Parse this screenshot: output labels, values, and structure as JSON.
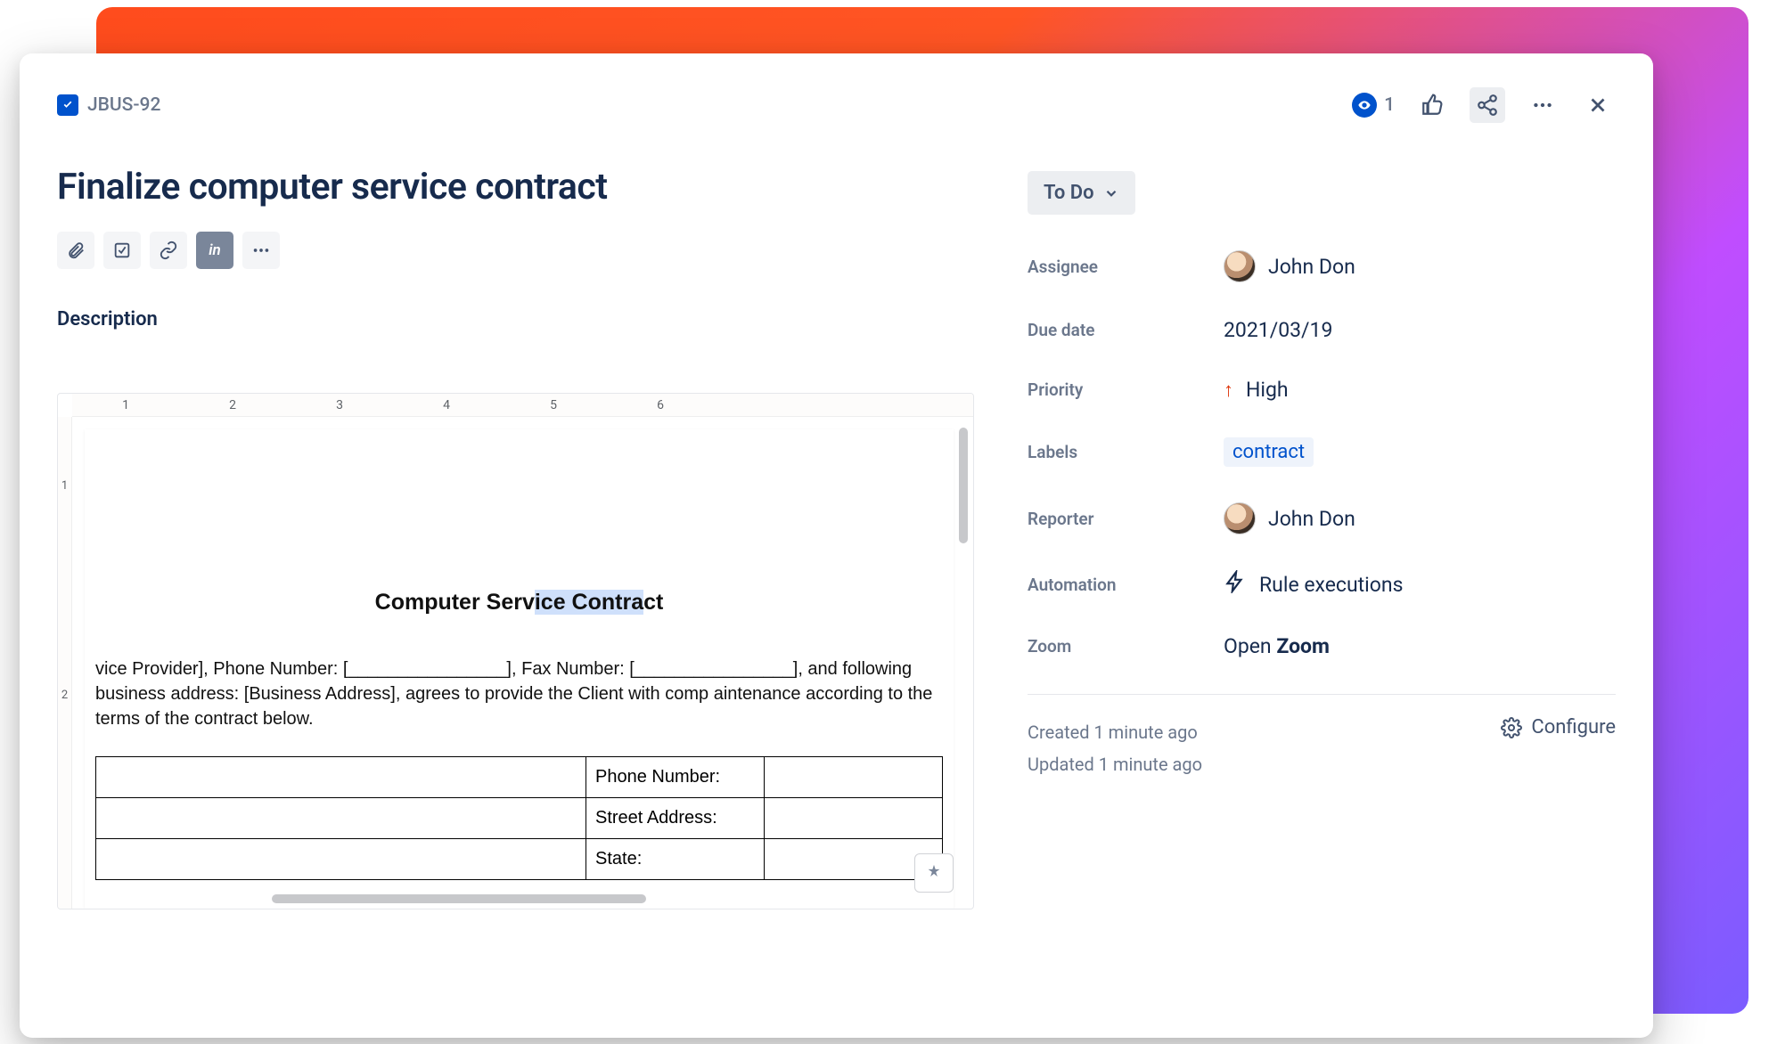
{
  "header": {
    "issue_key": "JBUS-92",
    "watch_count": "1"
  },
  "issue": {
    "title": "Finalize computer service contract",
    "description_label": "Description"
  },
  "status": {
    "label": "To Do"
  },
  "fields": {
    "assignee": {
      "label": "Assignee",
      "value": "John Don"
    },
    "due_date": {
      "label": "Due date",
      "value": "2021/03/19"
    },
    "priority": {
      "label": "Priority",
      "value": "High"
    },
    "labels": {
      "label": "Labels",
      "value": "contract"
    },
    "reporter": {
      "label": "Reporter",
      "value": "John Don"
    },
    "automation": {
      "label": "Automation",
      "value": "Rule executions"
    },
    "zoom": {
      "label": "Zoom",
      "value_prefix": "Open ",
      "value_bold": "Zoom"
    }
  },
  "meta": {
    "created": "Created 1 minute ago",
    "updated": "Updated 1 minute ago",
    "configure": "Configure"
  },
  "doc": {
    "ruler_numbers": [
      "1",
      "2",
      "3",
      "4",
      "5",
      "6"
    ],
    "vruler_numbers": [
      "1",
      "2"
    ],
    "title_plain": "Computer Serv",
    "title_hl": "ice Contra",
    "title_trail": "ct",
    "body_line": "vice Provider], Phone Number: [________________], Fax Number: [________________], and following business address: [Business Address], agrees to provide the Client with comp aintenance according to the terms of the contract below.",
    "table_rows": [
      "Phone Number:",
      "Street Address:",
      "State:"
    ]
  }
}
